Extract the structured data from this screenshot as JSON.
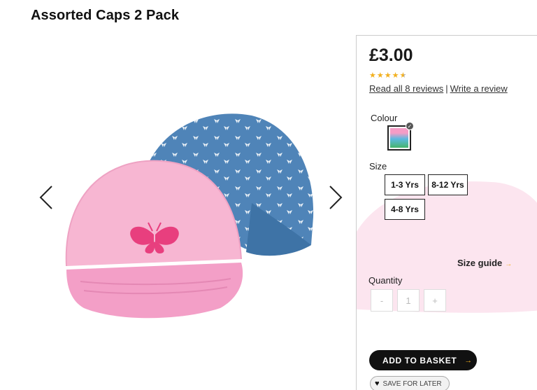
{
  "product": {
    "title": "Assorted Caps 2 Pack",
    "price": "£3.00",
    "rating": 4.5,
    "rating_max": 5
  },
  "reviews": {
    "read_all": "Read all 8 reviews",
    "separator": "|",
    "write": "Write a review"
  },
  "options": {
    "colour_label": "Colour",
    "size_label": "Size",
    "sizes": [
      "1-3 Yrs",
      "8-12 Yrs",
      "4-8 Yrs"
    ],
    "size_guide": "Size guide"
  },
  "quantity": {
    "label": "Quantity",
    "minus": "-",
    "value": "1",
    "plus": "+"
  },
  "actions": {
    "add_to_basket": "ADD TO BASKET",
    "save_for_later": "SAVE FOR LATER"
  },
  "icons": {
    "prev": "chevron-left-icon",
    "next": "chevron-right-icon",
    "arrow": "chevron-right-small-icon",
    "heart": "heart-icon",
    "check": "check-icon",
    "star": "star-icon"
  },
  "colors": {
    "accent": "#f2b01e",
    "pink_cap": "#f7b6d2",
    "blue_cap": "#4f84b8",
    "button": "#111111"
  }
}
